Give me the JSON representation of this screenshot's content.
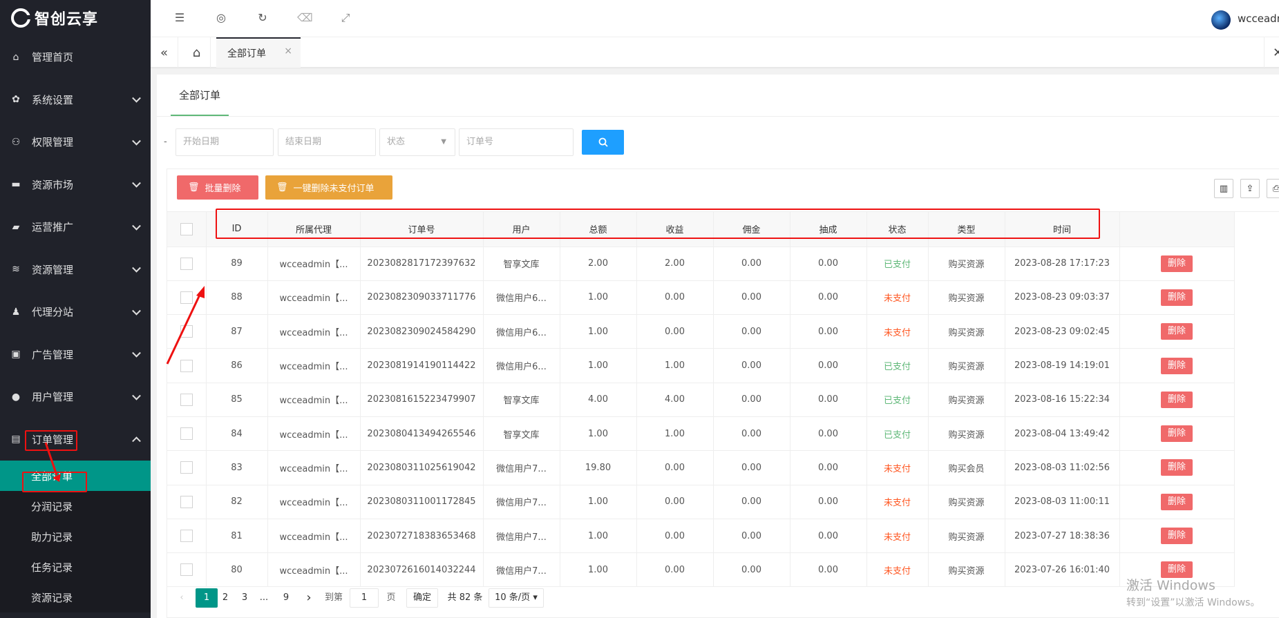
{
  "brand": "智创云享",
  "sidebar": {
    "items": [
      {
        "label": "管理首页",
        "icon": "home-icon"
      },
      {
        "label": "系统设置",
        "icon": "gear-icon"
      },
      {
        "label": "权限管理",
        "icon": "users-icon"
      },
      {
        "label": "资源市场",
        "icon": "store-icon"
      },
      {
        "label": "运营推广",
        "icon": "promo-icon"
      },
      {
        "label": "资源管理",
        "icon": "layers-icon"
      },
      {
        "label": "代理分站",
        "icon": "agent-icon"
      },
      {
        "label": "广告管理",
        "icon": "ad-icon"
      },
      {
        "label": "用户管理",
        "icon": "user-icon"
      },
      {
        "label": "订单管理",
        "icon": "order-icon"
      }
    ],
    "submenu": [
      "全部订单",
      "分润记录",
      "助力记录",
      "任务记录",
      "资源记录"
    ]
  },
  "header": {
    "username": "wcceadmin"
  },
  "tabs": {
    "active": "全部订单"
  },
  "content": {
    "tab": "全部订单",
    "filters": {
      "dash": "-",
      "start_date": "开始日期",
      "end_date": "结束日期",
      "status": "状态",
      "order_no": "订单号"
    },
    "buttons": {
      "batch_delete": "批量删除",
      "delete_unpaid": "一键删除未支付订单"
    },
    "columns": [
      "ID",
      "所属代理",
      "订单号",
      "用户",
      "总额",
      "收益",
      "佣金",
      "抽成",
      "状态",
      "类型",
      "时间"
    ],
    "delete_label": "删除",
    "rows": [
      {
        "id": "89",
        "agent": "wcceadmin【...",
        "order": "2023082817172397632",
        "user": "智享文库",
        "total": "2.00",
        "income": "2.00",
        "commission": "0.00",
        "cut": "0.00",
        "status": "已支付",
        "type": "购买资源",
        "time": "2023-08-28 17:17:23"
      },
      {
        "id": "88",
        "agent": "wcceadmin【...",
        "order": "2023082309033711776",
        "user": "微信用户6...",
        "total": "1.00",
        "income": "0.00",
        "commission": "0.00",
        "cut": "0.00",
        "status": "未支付",
        "type": "购买资源",
        "time": "2023-08-23 09:03:37"
      },
      {
        "id": "87",
        "agent": "wcceadmin【...",
        "order": "2023082309024584290",
        "user": "微信用户6...",
        "total": "1.00",
        "income": "0.00",
        "commission": "0.00",
        "cut": "0.00",
        "status": "未支付",
        "type": "购买资源",
        "time": "2023-08-23 09:02:45"
      },
      {
        "id": "86",
        "agent": "wcceadmin【...",
        "order": "2023081914190114422",
        "user": "微信用户6...",
        "total": "1.00",
        "income": "1.00",
        "commission": "0.00",
        "cut": "0.00",
        "status": "已支付",
        "type": "购买资源",
        "time": "2023-08-19 14:19:01"
      },
      {
        "id": "85",
        "agent": "wcceadmin【...",
        "order": "2023081615223479907",
        "user": "智享文库",
        "total": "4.00",
        "income": "4.00",
        "commission": "0.00",
        "cut": "0.00",
        "status": "已支付",
        "type": "购买资源",
        "time": "2023-08-16 15:22:34"
      },
      {
        "id": "84",
        "agent": "wcceadmin【...",
        "order": "2023080413494265546",
        "user": "智享文库",
        "total": "1.00",
        "income": "1.00",
        "commission": "0.00",
        "cut": "0.00",
        "status": "已支付",
        "type": "购买资源",
        "time": "2023-08-04 13:49:42"
      },
      {
        "id": "83",
        "agent": "wcceadmin【...",
        "order": "2023080311025619042",
        "user": "微信用户7...",
        "total": "19.80",
        "income": "0.00",
        "commission": "0.00",
        "cut": "0.00",
        "status": "未支付",
        "type": "购买会员",
        "time": "2023-08-03 11:02:56"
      },
      {
        "id": "82",
        "agent": "wcceadmin【...",
        "order": "2023080311001172845",
        "user": "微信用户7...",
        "total": "1.00",
        "income": "0.00",
        "commission": "0.00",
        "cut": "0.00",
        "status": "未支付",
        "type": "购买资源",
        "time": "2023-08-03 11:00:11"
      },
      {
        "id": "81",
        "agent": "wcceadmin【...",
        "order": "2023072718383653468",
        "user": "微信用户7...",
        "total": "1.00",
        "income": "0.00",
        "commission": "0.00",
        "cut": "0.00",
        "status": "未支付",
        "type": "购买资源",
        "time": "2023-07-27 18:38:36"
      },
      {
        "id": "80",
        "agent": "wcceadmin【...",
        "order": "2023072616014032244",
        "user": "微信用户7...",
        "total": "1.00",
        "income": "0.00",
        "commission": "0.00",
        "cut": "0.00",
        "status": "未支付",
        "type": "购买资源",
        "time": "2023-07-26 16:01:40"
      }
    ],
    "pager": {
      "pages": [
        "1",
        "2",
        "3",
        "...",
        "9"
      ],
      "goto": "到第",
      "current": "1",
      "page_unit": "页",
      "confirm": "确定",
      "total": "共 82 条",
      "per_page": "10 条/页"
    }
  },
  "watermark": {
    "line1": "激活 Windows",
    "line2": "转到“设置”以激活 Windows。"
  },
  "colors": {
    "sidebar_bg": "#20222a",
    "active_teal": "#009688",
    "paid": "#5fb878",
    "unpaid": "#ff5722",
    "delete_red": "#f0696a",
    "annotation": "#ee1111"
  }
}
